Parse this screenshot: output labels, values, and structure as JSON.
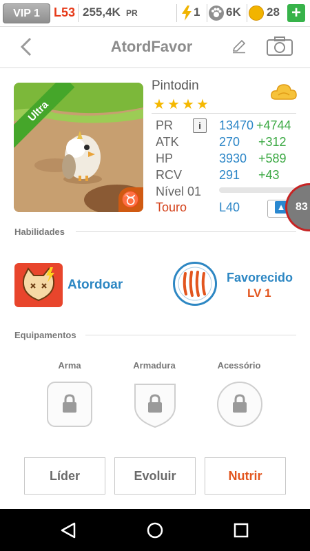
{
  "status_bar": {
    "vip_label": "VIP 1",
    "level": "L53",
    "power": "255,4K",
    "power_suffix": "PR",
    "energy": "1",
    "paws": "6K",
    "coins": "28",
    "plus": "+"
  },
  "header": {
    "title": "AtordFavor",
    "back_icon": "chevron-left-icon",
    "edit_icon": "pencil-icon",
    "camera_icon": "camera-icon"
  },
  "pet": {
    "rarity_ribbon": "Ultra",
    "name": "Pintodin",
    "stars": 4,
    "element_icon": "cloud-icon",
    "zodiac_symbol": "♉",
    "stats": [
      {
        "label": "PR",
        "value": "13470",
        "bonus": "+4744"
      },
      {
        "label": "ATK",
        "value": "270",
        "bonus": "+312"
      },
      {
        "label": "HP",
        "value": "3930",
        "bonus": "+589"
      },
      {
        "label": "RCV",
        "value": "291",
        "bonus": "+43"
      }
    ],
    "info_glyph": "i",
    "level_label": "Nível 01",
    "level_progress": 0,
    "sign": "Touro",
    "max_level": "L40",
    "floating_badge": "83"
  },
  "abilities": {
    "section_title": "Habilidades",
    "active_name": "Atordoar",
    "passive_name": "Favorecido",
    "passive_level": "LV 1"
  },
  "equipment": {
    "section_title": "Equipamentos",
    "slots": [
      {
        "label": "Arma"
      },
      {
        "label": "Armadura"
      },
      {
        "label": "Acessório"
      }
    ]
  },
  "actions": {
    "leader": "Líder",
    "evolve": "Evoluir",
    "feed": "Nutrir"
  },
  "colors": {
    "accent_blue": "#2d87c3",
    "bonus_green": "#3aa842",
    "alert_red": "#e63b1a",
    "feed_orange": "#e2551e"
  }
}
